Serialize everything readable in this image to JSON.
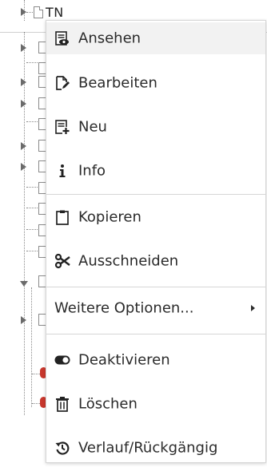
{
  "tree": {
    "visible_label": "TN"
  },
  "menu": {
    "items": [
      {
        "id": "view",
        "label": "Ansehen",
        "icon": "view-page-icon"
      },
      {
        "id": "edit",
        "label": "Bearbeiten",
        "icon": "edit-page-icon"
      },
      {
        "id": "new",
        "label": "Neu",
        "icon": "new-page-icon"
      },
      {
        "id": "info",
        "label": "Info",
        "icon": "info-icon"
      },
      {
        "id": "copy",
        "label": "Kopieren",
        "icon": "clipboard-icon"
      },
      {
        "id": "cut",
        "label": "Ausschneiden",
        "icon": "scissors-icon"
      },
      {
        "id": "more",
        "label": "Weitere Optionen...",
        "icon": "chevron-right-icon"
      },
      {
        "id": "disable",
        "label": "Deaktivieren",
        "icon": "toggle-icon"
      },
      {
        "id": "delete",
        "label": "Löschen",
        "icon": "trash-icon"
      },
      {
        "id": "history",
        "label": "Verlauf/Rückgängig",
        "icon": "history-icon"
      }
    ]
  },
  "colors": {
    "hover_bg": "#f2f2f2",
    "separator": "#d6d6d6",
    "text": "#2b2b2b",
    "tree_red": "#c8372d"
  }
}
